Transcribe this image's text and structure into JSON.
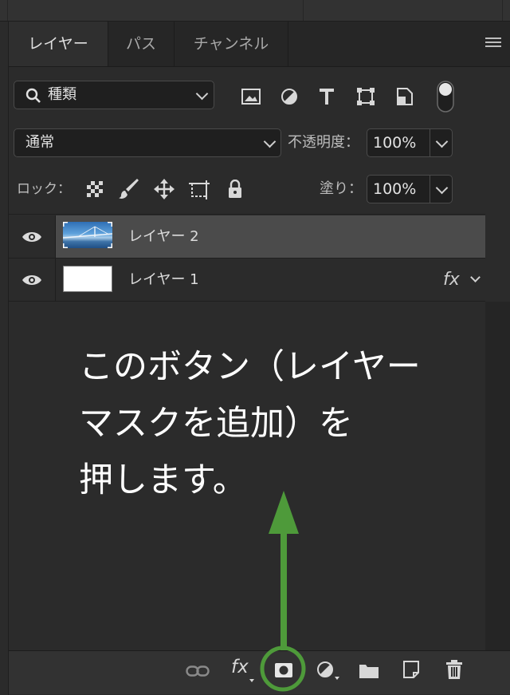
{
  "tabs": [
    {
      "label": "レイヤー",
      "active": true
    },
    {
      "label": "パス",
      "active": false
    },
    {
      "label": "チャンネル",
      "active": false
    }
  ],
  "filter": {
    "label": "種類"
  },
  "blend_mode": {
    "value": "通常"
  },
  "opacity": {
    "label": "不透明度：",
    "value": "100%"
  },
  "lock": {
    "label": "ロック："
  },
  "fill": {
    "label": "塗り：",
    "value": "100%"
  },
  "layers": [
    {
      "name": "レイヤー 2",
      "selected": true,
      "visible": true,
      "has_fx": false
    },
    {
      "name": "レイヤー 1",
      "selected": false,
      "visible": true,
      "has_fx": true,
      "fx_label": "fx"
    }
  ],
  "instruction": {
    "line1": "このボタン（レイヤー",
    "line2": "マスクを追加）を",
    "line3": "押します。"
  },
  "bottom_toolbar": {
    "fx_label": "fx"
  },
  "colors": {
    "arrow": "#4e9a3a",
    "highlight_circle": "#4e9a3a",
    "selected_layer": "#4b4b4b"
  }
}
